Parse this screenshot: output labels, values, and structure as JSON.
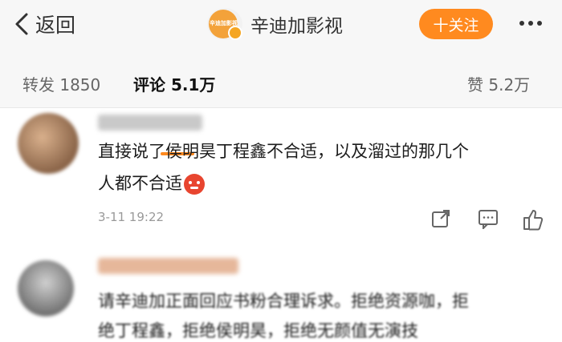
{
  "header": {
    "back_label": "返回",
    "account_name": "辛迪加影视",
    "logo_text": "辛迪加影视",
    "follow_label": "十关注"
  },
  "tabs": {
    "repost": "转发 1850",
    "comment": "评论 5.1万",
    "like": "赞 5.2万"
  },
  "comments": [
    {
      "line1": "直接说了侯明昊丁程鑫不合适，以及溜过的那几个",
      "line2": "人都不合适",
      "time": "3-11 19:22",
      "emoji": "angry-emoji"
    },
    {
      "line1": "请辛迪加正面回应书粉合理诉求。拒绝资源咖，拒",
      "line2": "绝丁程鑫，拒绝侯明昊，拒绝无颜值无演技"
    }
  ],
  "colors": {
    "accent": "#ff8a1f",
    "text": "#1c1c1c",
    "muted": "#999999"
  }
}
